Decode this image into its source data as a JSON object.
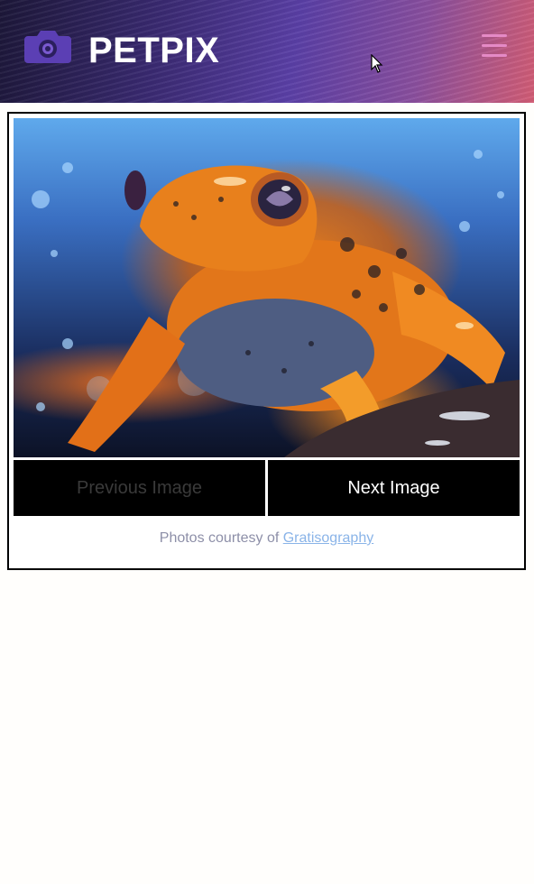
{
  "header": {
    "brand": "PETPIX",
    "logo_icon": "camera-icon",
    "menu_icon": "hamburger-menu-icon",
    "colors": {
      "brand_text": "#ffffff",
      "menu": "#e58ac6",
      "logo": "#5b3fb4"
    }
  },
  "gallery": {
    "image_alt": "Orange and black frog in the rain",
    "prev_label": "Previous Image",
    "next_label": "Next Image",
    "prev_enabled": false,
    "credit_prefix": "Photos courtesy of",
    "credit_link": "Gratisography"
  }
}
